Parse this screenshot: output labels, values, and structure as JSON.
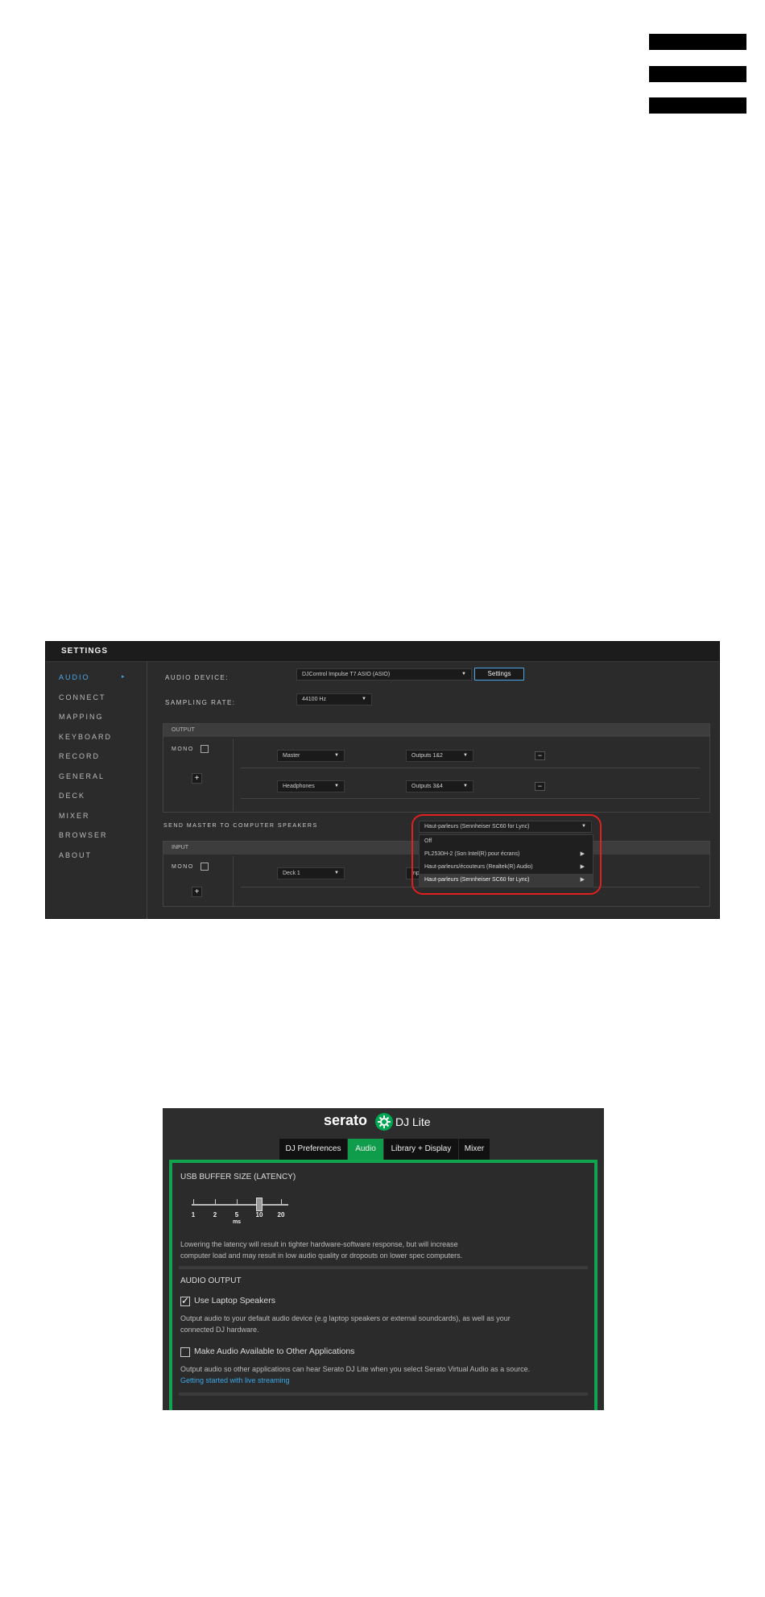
{
  "settings": {
    "title": "SETTINGS",
    "sidebar": [
      {
        "label": "AUDIO",
        "active": true
      },
      {
        "label": "CONNECT"
      },
      {
        "label": "MAPPING"
      },
      {
        "label": "KEYBOARD"
      },
      {
        "label": "RECORD"
      },
      {
        "label": "GENERAL"
      },
      {
        "label": "DECK"
      },
      {
        "label": "MIXER"
      },
      {
        "label": "BROWSER"
      },
      {
        "label": "ABOUT"
      }
    ],
    "audio_device_label": "AUDIO DEVICE:",
    "audio_device_value": "DJControl Impulse T7 ASIO (ASIO)",
    "settings_button": "Settings",
    "sampling_rate_label": "SAMPLING RATE:",
    "sampling_rate_value": "44100 Hz",
    "output": {
      "header": "OUTPUT",
      "mono_label": "MONO",
      "plus": "+",
      "rows": [
        {
          "source": "Master",
          "outputs": "Outputs 1&2",
          "remove": "−"
        },
        {
          "source": "Headphones",
          "outputs": "Outputs 3&4",
          "remove": "−"
        }
      ]
    },
    "send_master_label": "SEND MASTER TO COMPUTER SPEAKERS",
    "send_master_value": "Haut-parleurs (Sennheiser SC60 for Lync)",
    "send_master_options": [
      {
        "label": "Off",
        "submenu": false
      },
      {
        "label": "PL2530H-2 (Son Intel(R) pour écrans)",
        "submenu": true
      },
      {
        "label": "Haut-parleurs/écouteurs (Realtek(R) Audio)",
        "submenu": true
      },
      {
        "label": "Haut-parleurs (Sennheiser SC60 for Lync)",
        "submenu": true,
        "highlighted": true
      }
    ],
    "input": {
      "header": "INPUT",
      "mono_label": "MONO",
      "plus": "+",
      "rows": [
        {
          "source": "Deck 1",
          "outputs": "Inp"
        }
      ]
    },
    "caret": "▼",
    "tri": "▶",
    "sidebar_arrow": "▸"
  },
  "serato": {
    "logo_text": "serato",
    "logo_sub": "DJ Lite",
    "tabs": [
      "DJ Preferences",
      "Audio",
      "Library + Display",
      "Mixer"
    ],
    "active_tab": "Audio",
    "usb_buffer_title": "USB BUFFER SIZE (LATENCY)",
    "latency_ticks": [
      "1",
      "2",
      "5",
      "10",
      "20"
    ],
    "latency_unit": "ms",
    "latency_value": "10",
    "latency_note_line1": "Lowering the latency will result in tighter hardware-software response, but will increase",
    "latency_note_line2": "computer load and may result in low audio quality or dropouts on lower spec computers.",
    "audio_output_title": "AUDIO OUTPUT",
    "use_laptop_speakers_label": "Use Laptop Speakers",
    "use_laptop_speakers_checked": true,
    "use_laptop_note_line1": "Output audio to your default audio device (e.g laptop speakers or external soundcards), as well as your",
    "use_laptop_note_line2": "connected DJ hardware.",
    "make_available_label": "Make Audio Available to Other Applications",
    "make_available_checked": false,
    "make_available_note": "Output audio so other applications can hear Serato DJ Lite when you select Serato Virtual Audio as a source.",
    "live_streaming_link": "Getting started with live streaming",
    "checkmark": "✓"
  }
}
